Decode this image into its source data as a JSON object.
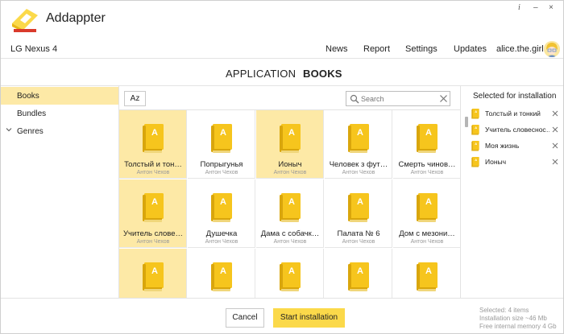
{
  "app": {
    "title": "Addappter",
    "window_controls": {
      "info": "i",
      "minimize": "–",
      "close": "×"
    }
  },
  "topbar": {
    "device": "LG Nexus 4",
    "nav": [
      "News",
      "Report",
      "Settings",
      "Updates"
    ],
    "user": "alice.the.girl"
  },
  "section_tabs": [
    {
      "label": "APPLICATION",
      "active": false
    },
    {
      "label": "BOOKS",
      "active": true
    }
  ],
  "sidebar": {
    "items": [
      {
        "label": "Books",
        "active": true,
        "expandable": false
      },
      {
        "label": "Bundles",
        "active": false,
        "expandable": false
      },
      {
        "label": "Genres",
        "active": false,
        "expandable": true
      }
    ]
  },
  "toolbar": {
    "sort_label": "Az",
    "search_placeholder": "Search"
  },
  "books": [
    {
      "title": "Толстый и тон…",
      "author": "Антон Чехов",
      "selected": true
    },
    {
      "title": "Попрыгунья",
      "author": "Антон Чехов",
      "selected": false
    },
    {
      "title": "Ионыч",
      "author": "Антон Чехов",
      "selected": true
    },
    {
      "title": "Человек з фут…",
      "author": "Антон Чехов",
      "selected": false
    },
    {
      "title": "Смерть чинов…",
      "author": "Антон Чехов",
      "selected": false
    },
    {
      "title": "Учитель слове…",
      "author": "Антон Чехов",
      "selected": true
    },
    {
      "title": "Душечка",
      "author": "Антон Чехов",
      "selected": false
    },
    {
      "title": "Дама с собачк…",
      "author": "Антон Чехов",
      "selected": false
    },
    {
      "title": "Палата № 6",
      "author": "Антон Чехов",
      "selected": false
    },
    {
      "title": "Дом с мезони…",
      "author": "Антон Чехов",
      "selected": false
    },
    {
      "title": "",
      "author": "",
      "selected": true
    },
    {
      "title": "",
      "author": "",
      "selected": false
    },
    {
      "title": "",
      "author": "",
      "selected": false
    },
    {
      "title": "",
      "author": "",
      "selected": false
    },
    {
      "title": "",
      "author": "",
      "selected": false
    }
  ],
  "selected_panel": {
    "title": "Selected for installation",
    "items": [
      "Толстый и тонкий",
      "Учитель словеснос…",
      "Моя жизнь",
      "Ионыч"
    ]
  },
  "footer": {
    "cancel_label": "Cancel",
    "start_label": "Start installation",
    "info": [
      "Selected: 4 items",
      "Installation size ~46 Mb",
      "Free internal memory 4 Gb"
    ]
  },
  "colors": {
    "accent": "#fbd94a",
    "selected_bg": "#fde9a6",
    "book_cover": "#f6c51d",
    "book_spine": "#d9a60c",
    "logo_red": "#d93a2b"
  },
  "icons": {
    "logo": "addappter-logo-icon",
    "book": "book-icon",
    "search": "search-icon",
    "clear": "clear-icon",
    "remove": "close-icon",
    "chevron": "chevron-down-icon"
  }
}
